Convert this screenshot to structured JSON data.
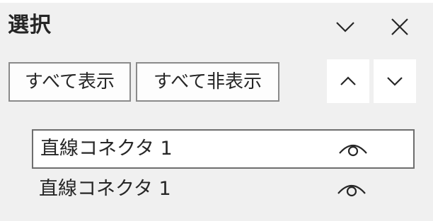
{
  "pane": {
    "title": "選択",
    "collapse_icon": "chevron-down-icon",
    "close_icon": "close-icon"
  },
  "toolbar": {
    "show_all_label": "すべて表示",
    "hide_all_label": "すべて非表示",
    "bring_forward_icon": "chevron-up-icon",
    "send_backward_icon": "chevron-down-icon"
  },
  "objects": [
    {
      "label": "直線コネクタ 1",
      "selected": true,
      "visibility_icon": "eye-icon"
    },
    {
      "label": "直線コネクタ 1",
      "selected": false,
      "visibility_icon": "eye-icon"
    }
  ],
  "colors": {
    "background": "#f0f0f0",
    "text": "#262626",
    "button_border": "#8a8a8a",
    "selected_row_bg": "#ffffff"
  }
}
